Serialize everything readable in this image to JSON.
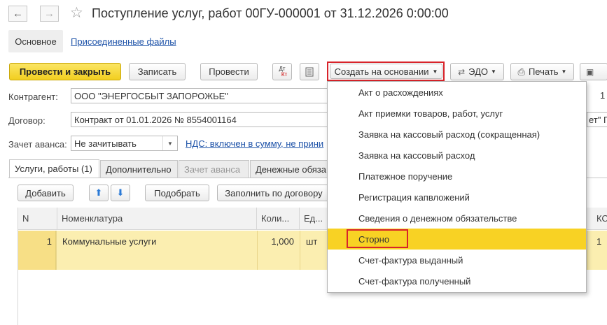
{
  "window": {
    "title": "Поступление услуг, работ 00ГУ-000001 от 31.12.2026 0:00:00",
    "back_icon": "arrow-left-icon",
    "forward_icon": "arrow-right-icon",
    "favorite_icon": "star-icon"
  },
  "sections": {
    "main": "Основное",
    "files": "Присоединенные файлы"
  },
  "toolbar": {
    "post_close": "Провести и закрыть",
    "save": "Записать",
    "post": "Провести",
    "dtkt_dt": "Дт",
    "dtkt_kt": "Кт",
    "create_based": "Создать на основании",
    "edo": "ЭДО",
    "print": "Печать"
  },
  "form": {
    "counterparty_label": "Контрагент:",
    "counterparty_value": "ООО \"ЭНЕРГОСБЫТ ЗАПОРОЖЬЕ\"",
    "contract_label": "Договор:",
    "contract_value": "Контракт от 01.01.2026 № 8554001164",
    "advance_label": "Зачет аванса:",
    "advance_value": "Не зачитывать",
    "vat_link": "НДС: включен в сумму, не прини",
    "right_edge_1": "1",
    "right_edge_2": "ет\" ГС"
  },
  "tabs": [
    {
      "label": "Услуги, работы (1)"
    },
    {
      "label": "Дополнительно"
    },
    {
      "label": "Зачет аванса"
    },
    {
      "label": "Денежные обяза"
    }
  ],
  "table_toolbar": {
    "add": "Добавить",
    "pick": "Подобрать",
    "fill": "Заполнить по договору"
  },
  "table": {
    "columns": [
      "N",
      "Номенклатура",
      "Коли...",
      "Ед...",
      "КС"
    ],
    "rows": [
      {
        "n": "1",
        "item": "Коммунальные услуги",
        "qty": "1,000",
        "unit": "шт",
        "extra": "1"
      }
    ]
  },
  "menu": {
    "items": [
      "Акт о расхождениях",
      "Акт приемки товаров, работ, услуг",
      "Заявка на кассовый расход (сокращенная)",
      "Заявка на кассовый расход",
      "Платежное поручение",
      "Регистрация капвложений",
      "Сведения о денежном обязательстве",
      "Сторно",
      "Счет-фактура выданный",
      "Счет-фактура полученный"
    ],
    "selected_index": 7
  },
  "colors": {
    "primary_button": "#f2cf1f",
    "selected_row": "#fbeeb0",
    "menu_highlight": "#f8d224",
    "link": "#1d52a8",
    "highlight_frame": "#d8232a"
  }
}
